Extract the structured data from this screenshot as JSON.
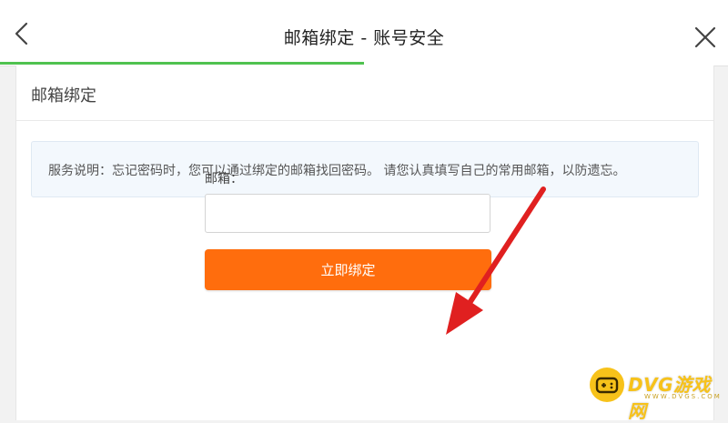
{
  "header": {
    "title": "邮箱绑定 - 账号安全",
    "back_icon": "chevron-left-icon",
    "close_icon": "close-icon",
    "progress_fraction": 0.5,
    "progress_color": "#4fc24f"
  },
  "card": {
    "title": "邮箱绑定",
    "notice": "服务说明：忘记密码时，您可以通过绑定的邮箱找回密码。 请您认真填写自己的常用邮箱，以防遗忘。"
  },
  "form": {
    "email_label": "邮箱：",
    "email_value": "",
    "email_placeholder": "",
    "submit_label": "立即绑定",
    "submit_color": "#ff6d0d"
  },
  "annotation": {
    "arrow_color": "#e02020"
  },
  "watermark": {
    "logo_icon": "gamepad-icon",
    "text": "DVG游戏网",
    "subtext": "WWW.DVGS.COM"
  }
}
